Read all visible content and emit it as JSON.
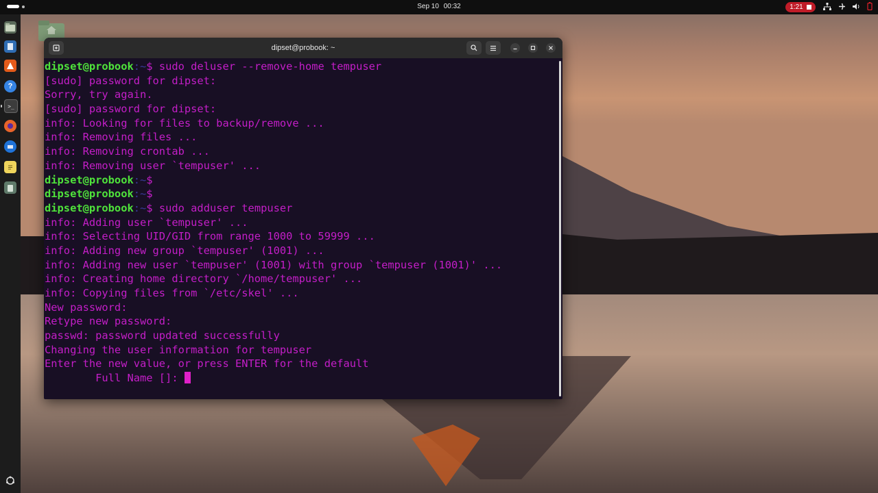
{
  "topbar": {
    "date": "Sep 10",
    "time": "00:32",
    "recording_time": "1:21"
  },
  "dock": {
    "items": [
      "files-icon",
      "text-editor-blue-icon",
      "app-center-icon",
      "help-icon",
      "terminal-icon",
      "firefox-icon",
      "thunderbird-icon",
      "notes-icon",
      "trash-icon"
    ],
    "bottom": "show-apps-icon"
  },
  "terminal": {
    "title": "dipset@probook: ~",
    "lines": [
      {
        "prompt": "dipset@probook",
        "sep": ":~",
        "dollar": "$",
        "cmd": " sudo deluser --remove-home tempuser"
      },
      {
        "text": "[sudo] password for dipset:"
      },
      {
        "text": "Sorry, try again."
      },
      {
        "text": "[sudo] password for dipset:"
      },
      {
        "text": "info: Looking for files to backup/remove ..."
      },
      {
        "text": "info: Removing files ..."
      },
      {
        "text": "info: Removing crontab ..."
      },
      {
        "text": "info: Removing user `tempuser' ..."
      },
      {
        "prompt": "dipset@probook",
        "sep": ":~",
        "dollar": "$",
        "cmd": ""
      },
      {
        "prompt": "dipset@probook",
        "sep": ":~",
        "dollar": "$",
        "cmd": ""
      },
      {
        "prompt": "dipset@probook",
        "sep": ":~",
        "dollar": "$",
        "cmd": " sudo adduser tempuser"
      },
      {
        "text": "info: Adding user `tempuser' ..."
      },
      {
        "text": "info: Selecting UID/GID from range 1000 to 59999 ..."
      },
      {
        "text": "info: Adding new group `tempuser' (1001) ..."
      },
      {
        "text": "info: Adding new user `tempuser' (1001) with group `tempuser (1001)' ..."
      },
      {
        "text": "info: Creating home directory `/home/tempuser' ..."
      },
      {
        "text": "info: Copying files from `/etc/skel' ..."
      },
      {
        "text": "New password:"
      },
      {
        "text": "Retype new password:"
      },
      {
        "text": "passwd: password updated successfully"
      },
      {
        "text": "Changing the user information for tempuser"
      },
      {
        "text": "Enter the new value, or press ENTER for the default"
      },
      {
        "text": "        Full Name []: ",
        "cursor": true
      }
    ]
  },
  "colors": {
    "prompt_user": "#4fe33b",
    "terminal_text": "#c41ec8",
    "terminal_bg": "#180f24",
    "recording": "#c01c28"
  }
}
